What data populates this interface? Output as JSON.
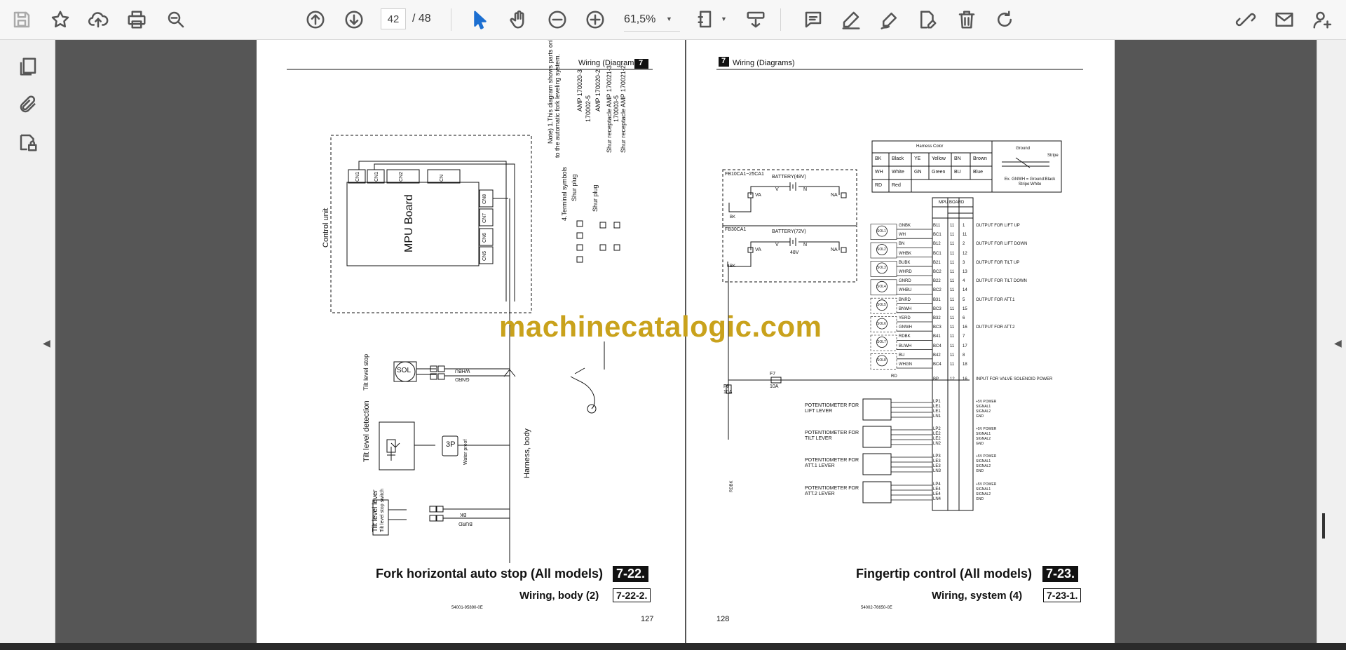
{
  "toolbar": {
    "current_page": "42",
    "total_pages": "/ 48",
    "zoom": "61,5%"
  },
  "page_left": {
    "header": "Wiring (Diagrams)",
    "chapter": "7",
    "control_unit": "Control unit",
    "mpu_board": "MPU Board",
    "connectors": [
      "CN1",
      "CN1",
      "CN2",
      "CN",
      "CN8",
      "CN7",
      "CN6",
      "CN5"
    ],
    "note_lines": [
      "Note) 1.This diagram shows parts only relevant",
      "to the automatic fork leveling system.",
      "4.Terminal symbols",
      "Shur plug",
      "Shur plug",
      "Shur receptacle AMP 170021-3",
      "Shur receptacle AMP 170021-2"
    ],
    "amp_codes": [
      "AMP 170020-3",
      "170002-5",
      "AMP 170020-2",
      "170003-5"
    ],
    "tilt_level_stop": "Tilt level stop",
    "sol": "SOL",
    "wire_whbu": "WHBU",
    "wire_gnrd": "GNRD",
    "tilt_level_detection": "Tilt level detection",
    "plug_3p": "3P",
    "water_proof": "Water proof",
    "harness_body": "Harness, body",
    "tilt_level_lever": "Tilt level lever",
    "tilt_level_stop_switch": "Tilt level stop switch",
    "wire_bk": "BK",
    "wire_burd": "BURD",
    "section_title": "Fork horizontal auto stop (All models)",
    "section_num": "7-22.",
    "sub_title": "Wiring, body (2)",
    "sub_num": "7-22-2.",
    "doc_code": "54001-95890-0E",
    "page_number": "127"
  },
  "page_right": {
    "chapter": "7",
    "header": "Wiring (Diagrams)",
    "harness_color_title": "Harness Color",
    "harness_colors": [
      [
        "BK",
        "Black",
        "YE",
        "Yellow",
        "BN",
        "Brown"
      ],
      [
        "WH",
        "White",
        "GN",
        "Green",
        "BU",
        "Blue"
      ],
      [
        "RD",
        "Red",
        "",
        "",
        "",
        ""
      ]
    ],
    "ground_label": "Ground",
    "stripe_label": "Stripe",
    "example_note": "Ex. GNWH = Ground:Black Stripe:White",
    "battery48_box": "FB10CA1~25CA1",
    "battery48": "BATTERY(48V)",
    "battery72_box": "FB30CA1",
    "battery72": "BATTERY(72V)",
    "v48": "48V",
    "va": "VA",
    "na": "NA",
    "v": "V",
    "n": "N",
    "bk": "BK",
    "mpu_board": "MPU BOARD",
    "sol_rows": [
      {
        "wire": "GNBK",
        "pin": "B11",
        "a": "11",
        "b": "1",
        "label": "OUTPUT FOR LIFT UP"
      },
      {
        "wire": "WH",
        "pin": "BC1",
        "a": "11",
        "b": "11",
        "label": ""
      },
      {
        "wire": "BN",
        "pin": "B12",
        "a": "11",
        "b": "2",
        "label": "OUTPUT FOR LIFT DOWN"
      },
      {
        "wire": "WHBK",
        "pin": "BC1",
        "a": "11",
        "b": "12",
        "label": ""
      },
      {
        "wire": "BUBK",
        "pin": "B21",
        "a": "11",
        "b": "3",
        "label": "OUTPUT FOR TILT UP"
      },
      {
        "wire": "WHRD",
        "pin": "BC2",
        "a": "11",
        "b": "13",
        "label": ""
      },
      {
        "wire": "GNRD",
        "pin": "B22",
        "a": "11",
        "b": "4",
        "label": "OUTPUT FOR TILT DOWN"
      },
      {
        "wire": "WHBU",
        "pin": "BC2",
        "a": "11",
        "b": "14",
        "label": ""
      },
      {
        "wire": "BNRD",
        "pin": "B31",
        "a": "11",
        "b": "5",
        "label": "OUTPUT FOR ATT.1"
      },
      {
        "wire": "BNWH",
        "pin": "BC3",
        "a": "11",
        "b": "15",
        "label": ""
      },
      {
        "wire": "YERD",
        "pin": "B32",
        "a": "11",
        "b": "6",
        "label": ""
      },
      {
        "wire": "GNWH",
        "pin": "BC3",
        "a": "11",
        "b": "16",
        "label": "OUTPUT FOR ATT.2"
      },
      {
        "wire": "RDBK",
        "pin": "B41",
        "a": "11",
        "b": "7",
        "label": ""
      },
      {
        "wire": "BUWH",
        "pin": "BC4",
        "a": "11",
        "b": "17",
        "label": ""
      },
      {
        "wire": "BU",
        "pin": "B42",
        "a": "11",
        "b": "8",
        "label": ""
      },
      {
        "wire": "WHGN",
        "pin": "BC4",
        "a": "11",
        "b": "18",
        "label": ""
      }
    ],
    "sol_labels": [
      "SOL1",
      "SOL2",
      "SOL3",
      "SOL4",
      "SOL5",
      "SOL6",
      "SOL7",
      "SOL8"
    ],
    "bp_row": {
      "wire": "RD",
      "pin": "BP",
      "a": "12",
      "b": "16",
      "label": "INPUT FOR VALVE SOLENOID POWER"
    },
    "fuse_f6": "F6",
    "fuse_f6_rating": "10A",
    "fuse_f7": "F7",
    "fuse_f7_rating": "10A",
    "rdbk": "RDBK",
    "pot_groups": [
      {
        "label1": "POTENTIOMETER FOR",
        "label2": "LIFT LEVER",
        "pins": [
          "LP1",
          "LE1",
          "LE1",
          "LN1"
        ]
      },
      {
        "label1": "POTENTIOMETER FOR",
        "label2": "TILT LEVER",
        "pins": [
          "LP2",
          "LE2",
          "LE2",
          "LN2"
        ]
      },
      {
        "label1": "POTENTIOMETER FOR",
        "label2": "ATT.1 LEVER",
        "pins": [
          "LP3",
          "LE3",
          "LE3",
          "LN3"
        ]
      },
      {
        "label1": "POTENTIOMETER FOR",
        "label2": "ATT.2 LEVER",
        "pins": [
          "LP4",
          "LE4",
          "LE4",
          "LN4"
        ]
      }
    ],
    "signal_labels": [
      "+5V POWER",
      "SIGNAL1",
      "SIGNAL2",
      "GND"
    ],
    "section_title": "Fingertip control (All models)",
    "section_num": "7-23.",
    "sub_title": "Wiring, system (4)",
    "sub_num": "7-23-1.",
    "doc_code": "54002-76650-0E",
    "page_number": "128"
  },
  "watermark": "machinecatalogic.com"
}
